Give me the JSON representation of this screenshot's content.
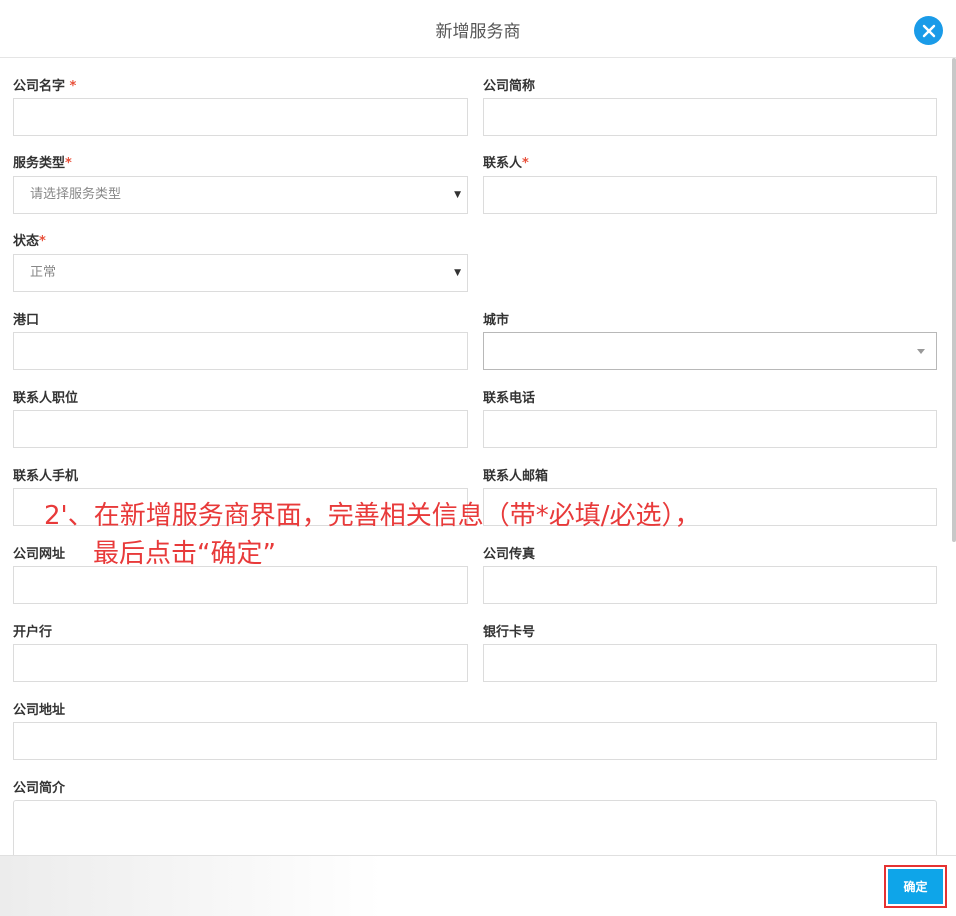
{
  "dialog": {
    "title": "新增服务商",
    "confirm_label": "确定"
  },
  "fields": {
    "company_name": {
      "label": "公司名字",
      "required": "*"
    },
    "short_name": {
      "label": "公司简称"
    },
    "service_type": {
      "label": "服务类型",
      "required": "*",
      "placeholder": "请选择服务类型"
    },
    "contact": {
      "label": "联系人",
      "required": "*"
    },
    "status": {
      "label": "状态",
      "required": "*",
      "value": "正常"
    },
    "port": {
      "label": "港口"
    },
    "city": {
      "label": "城市"
    },
    "contact_position": {
      "label": "联系人职位"
    },
    "contact_phone": {
      "label": "联系电话"
    },
    "contact_mobile": {
      "label": "联系人手机"
    },
    "contact_email": {
      "label": "联系人邮箱"
    },
    "website": {
      "label": "公司网址"
    },
    "fax": {
      "label": "公司传真"
    },
    "bank": {
      "label": "开户行"
    },
    "card_no": {
      "label": "银行卡号"
    },
    "address": {
      "label": "公司地址"
    },
    "intro": {
      "label": "公司简介"
    }
  },
  "annotation": {
    "line1": "2'、在新增服务商界面，完善相关信息（带*必填/必选），",
    "line2": "最后点击“确定”"
  },
  "colors": {
    "accent": "#0ea5e9",
    "close": "#1a9be8",
    "required": "#e8503a",
    "annotation": "#e83a3a"
  },
  "icons": {
    "close": "close-icon",
    "dropdown": "caret-down-icon"
  }
}
